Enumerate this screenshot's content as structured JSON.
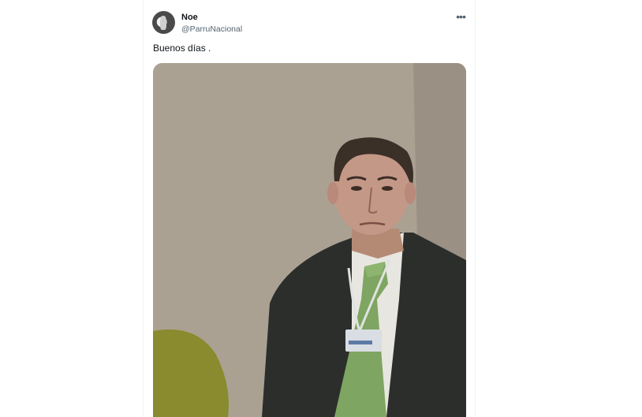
{
  "tweet": {
    "author_name": "Noe",
    "author_handle": "@ParruNacional",
    "text": "Buenos días .",
    "more_icon": "more-horizontal-icon"
  },
  "media": {
    "type": "photo",
    "description_icon": "tweet-photo"
  },
  "colors": {
    "name": "#0f1419",
    "handle": "#536471",
    "wall": "#ab a192",
    "tie": "#7ea561"
  }
}
